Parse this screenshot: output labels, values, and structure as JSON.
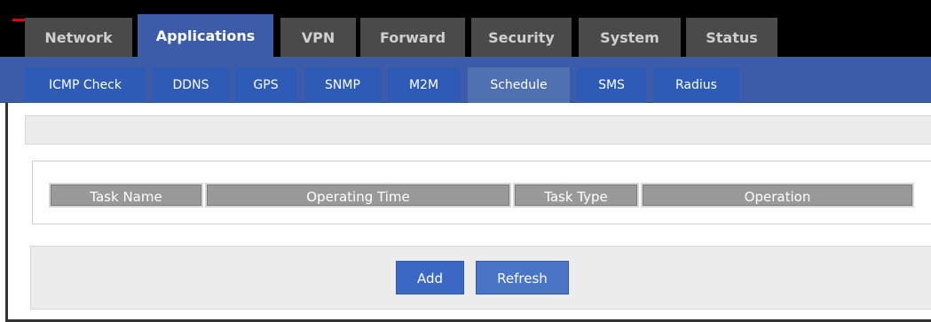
{
  "main_tabs": [
    "Network",
    "Applications",
    "VPN",
    "Forward",
    "Security",
    "System",
    "Status"
  ],
  "active_main_tab": "Applications",
  "sub_tabs": [
    "ICMP Check",
    "DDNS",
    "GPS",
    "SNMP",
    "M2M",
    "Schedule",
    "SMS",
    "Radius"
  ],
  "active_sub_tab": "Schedule",
  "table": {
    "columns": [
      "Task Name",
      "Operating Time",
      "Task Type",
      "Operation"
    ],
    "rows": []
  },
  "buttons": {
    "add": "Add",
    "refresh": "Refresh"
  },
  "colors": {
    "accent_blue": "#3c5ba8",
    "header_black": "#000000",
    "tab_gray": "#4a4a4a"
  }
}
